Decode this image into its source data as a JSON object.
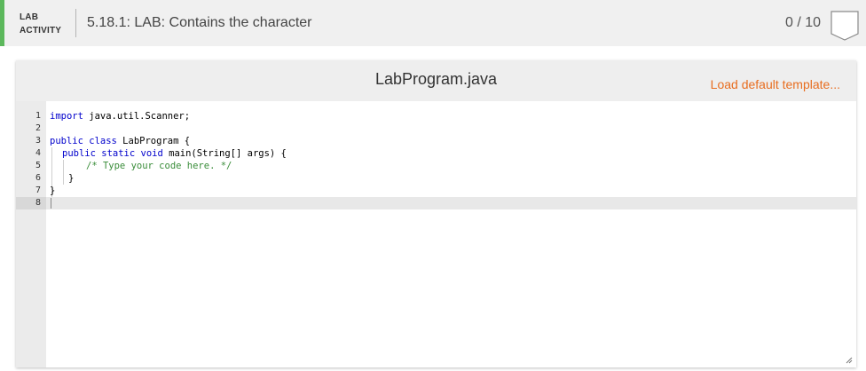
{
  "header": {
    "lab_tag_line1": "LAB",
    "lab_tag_line2": "ACTIVITY",
    "title": "5.18.1: LAB: Contains the character",
    "score": "0 / 10",
    "accent_color": "#5cb85c"
  },
  "editor": {
    "file_name": "LabProgram.java",
    "load_template_label": "Load default template...",
    "link_color": "#e86d1f",
    "active_line": 8,
    "line_numbers": [
      "1",
      "2",
      "3",
      "4",
      "5",
      "6",
      "7",
      "8"
    ],
    "code": {
      "l1_kw": "import",
      "l1_rest": " java.util.Scanner;",
      "l3_kw": "public class",
      "l3_rest": " LabProgram {",
      "l4_kw": "public static void",
      "l4_rest": " main(String[] args) {",
      "l5_comment": "/* Type your code here. */",
      "l6": "}",
      "l7": "}"
    }
  },
  "icons": {
    "badge": "completion-badge-icon",
    "resize": "resize-handle-icon"
  }
}
